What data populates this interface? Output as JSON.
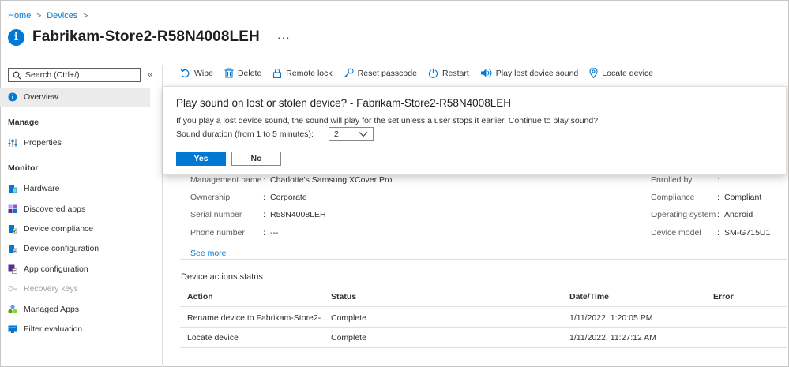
{
  "breadcrumb": {
    "home": "Home",
    "devices": "Devices"
  },
  "header": {
    "icon": "info-icon",
    "title": "Fabrikam-Store2-R58N4008LEH",
    "more": "···"
  },
  "sidebar": {
    "search_placeholder": "Search (Ctrl+/)",
    "collapse": "«",
    "overview": "Overview",
    "manage_heading": "Manage",
    "properties": "Properties",
    "monitor_heading": "Monitor",
    "monitor_items": [
      {
        "label": "Hardware",
        "icon": "hardware-icon"
      },
      {
        "label": "Discovered apps",
        "icon": "discovered-apps-icon"
      },
      {
        "label": "Device compliance",
        "icon": "device-compliance-icon"
      },
      {
        "label": "Device configuration",
        "icon": "device-configuration-icon"
      },
      {
        "label": "App configuration",
        "icon": "app-configuration-icon"
      },
      {
        "label": "Recovery keys",
        "icon": "key-icon"
      },
      {
        "label": "Managed Apps",
        "icon": "managed-apps-icon"
      },
      {
        "label": "Filter evaluation",
        "icon": "filter-evaluation-icon"
      }
    ]
  },
  "toolbar": {
    "wipe": "Wipe",
    "delete": "Delete",
    "remote_lock": "Remote lock",
    "reset_passcode": "Reset passcode",
    "restart": "Restart",
    "play_sound": "Play lost device sound",
    "locate": "Locate device"
  },
  "dialog": {
    "title": "Play sound on lost or stolen device? - Fabrikam-Store2-R58N4008LEH",
    "message": "If you play a lost device sound, the sound will play for the set unless a user stops it earlier. Continue to play sound?",
    "duration_label": "Sound duration (from 1 to 5 minutes):",
    "duration_value": "2",
    "yes": "Yes",
    "no": "No"
  },
  "properties": {
    "left": [
      {
        "label": "Management name",
        "value": "Charlotte's Samsung XCover Pro"
      },
      {
        "label": "Ownership",
        "value": "Corporate"
      },
      {
        "label": "Serial number",
        "value": "R58N4008LEH"
      },
      {
        "label": "Phone number",
        "value": "---"
      }
    ],
    "right": [
      {
        "label": "Enrolled by",
        "value": ""
      },
      {
        "label": "Compliance",
        "value": "Compliant"
      },
      {
        "label": "Operating system",
        "value": "Android"
      },
      {
        "label": "Device model",
        "value": "SM-G715U1"
      }
    ],
    "separator": ":",
    "see_more": "See more"
  },
  "actions_status": {
    "title": "Device actions status",
    "columns": [
      "Action",
      "Status",
      "Date/Time",
      "Error"
    ],
    "rows": [
      {
        "action": "Rename device to Fabrikam-Store2-...",
        "status": "Complete",
        "datetime": "1/11/2022, 1:20:05 PM",
        "error": ""
      },
      {
        "action": "Locate device",
        "status": "Complete",
        "datetime": "1/11/2022, 11:27:12 AM",
        "error": ""
      }
    ]
  },
  "colors": {
    "accent": "#0078d4",
    "text": "#323130",
    "muted": "#605e5c"
  }
}
